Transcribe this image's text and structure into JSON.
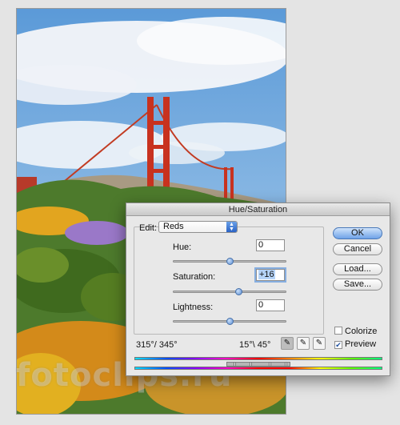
{
  "dialog": {
    "title": "Hue/Saturation",
    "edit_label": "Edit:",
    "edit_value": "Reds",
    "sliders": {
      "hue": {
        "label": "Hue:",
        "value": "0",
        "level": 0.5
      },
      "saturation": {
        "label": "Saturation:",
        "value": "+16",
        "level": 0.58
      },
      "lightness": {
        "label": "Lightness:",
        "value": "0",
        "level": 0.5
      }
    },
    "buttons": {
      "ok": "OK",
      "cancel": "Cancel",
      "load": "Load...",
      "save": "Save..."
    },
    "colorize": {
      "label": "Colorize",
      "checked": false
    },
    "preview": {
      "label": "Preview",
      "checked": true
    },
    "range_left": "315°/ 345°",
    "range_right": "15°\\ 45°"
  },
  "watermark": "fotoclips.ru",
  "icons": [
    "eyedropper-icon",
    "eyedropper-plus-icon",
    "eyedropper-minus-icon",
    "dropdown-arrow-icon",
    "checkmark-icon"
  ]
}
